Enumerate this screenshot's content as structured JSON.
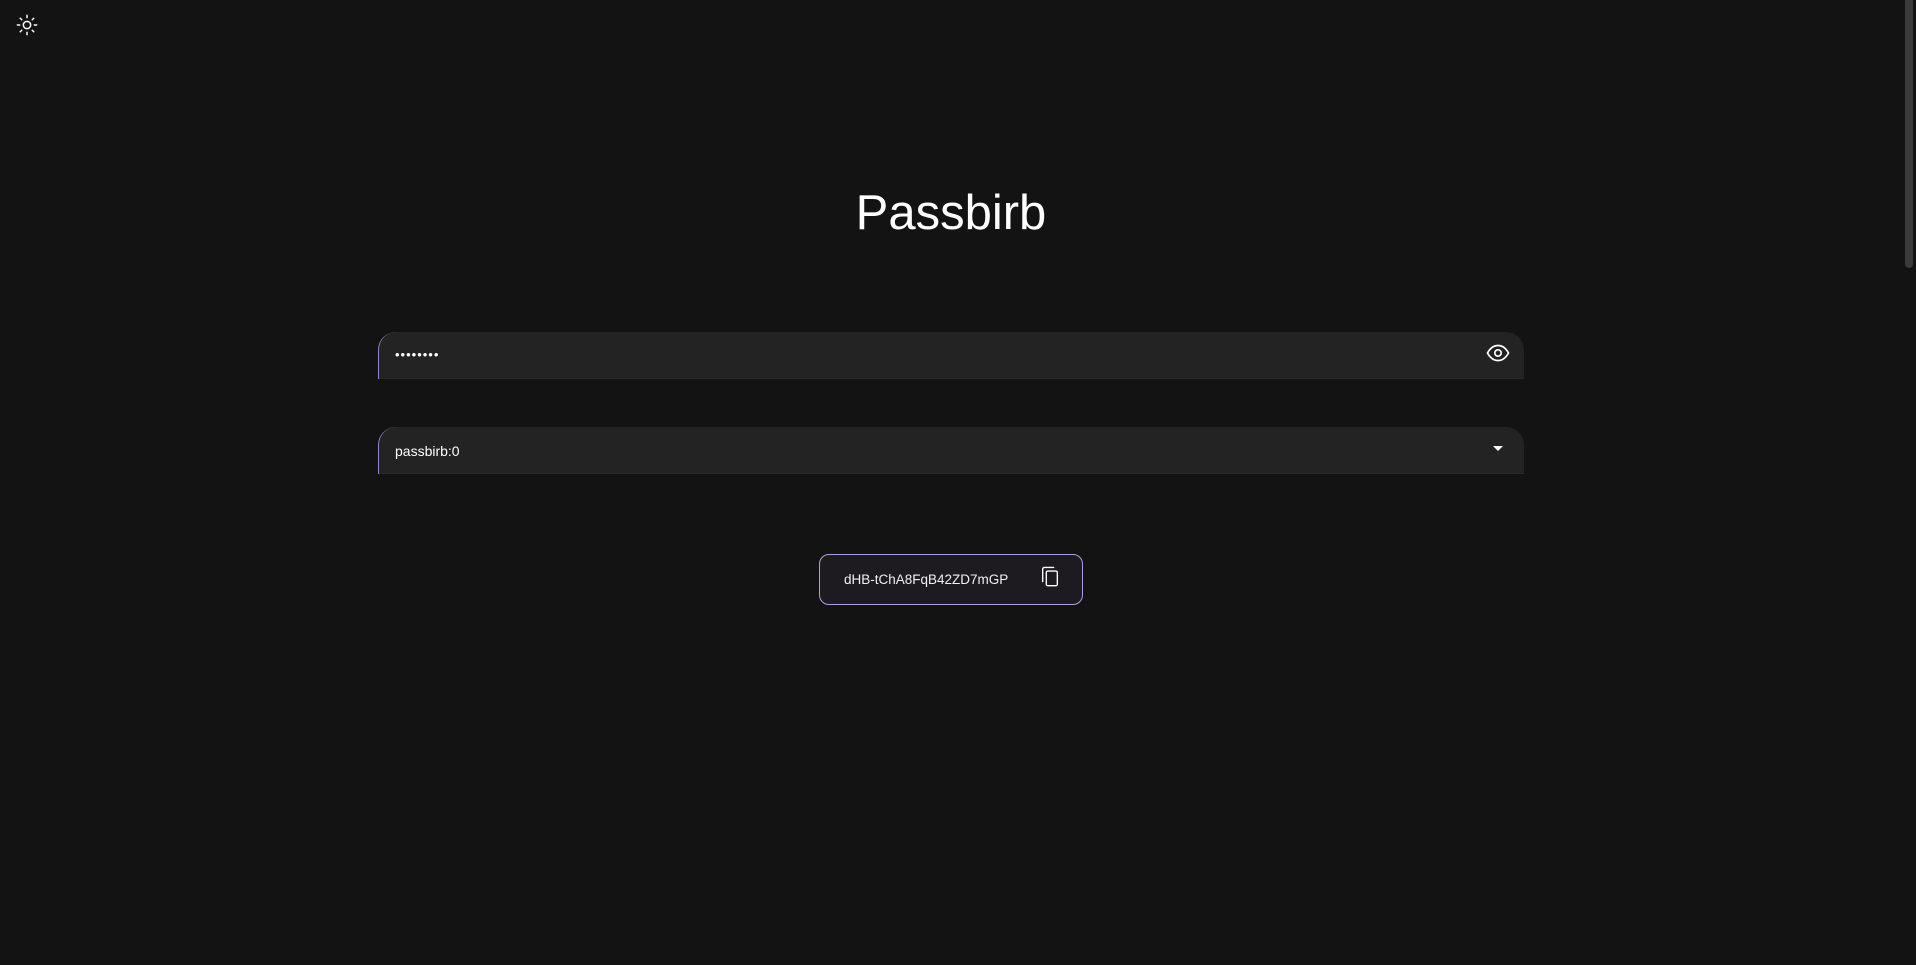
{
  "header": {
    "theme_icon": "sun-icon"
  },
  "main": {
    "title": "Passbirb",
    "password_field": {
      "value": "••••••••",
      "toggle_icon": "eye-icon"
    },
    "algorithm_select": {
      "selected": "passbirb:0",
      "dropdown_icon": "caret-down-icon"
    },
    "result": {
      "password": "dHB-tChA8FqB42ZD7mGP",
      "copy_icon": "copy-icon"
    }
  },
  "colors": {
    "background": "#131313",
    "field_background": "#232323",
    "accent": "#b49be3"
  }
}
